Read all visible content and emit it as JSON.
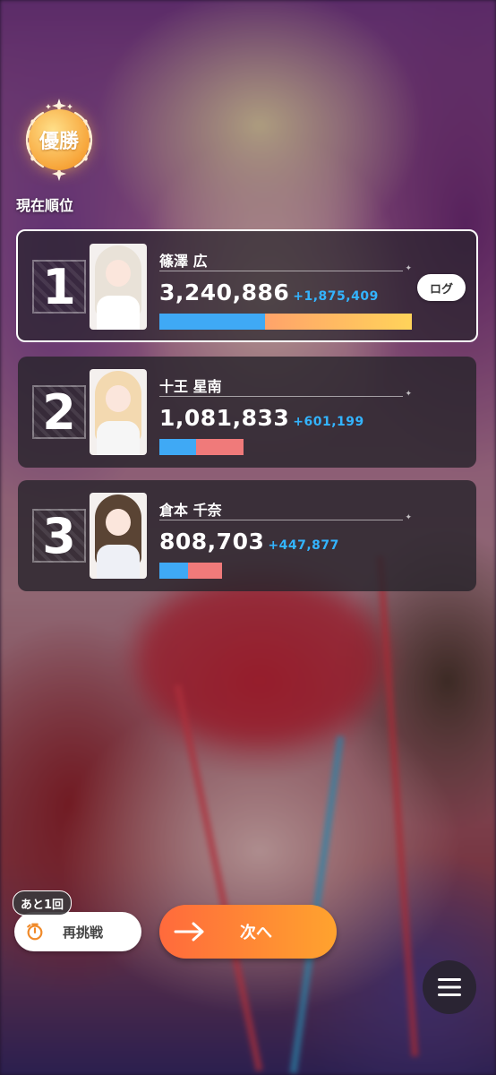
{
  "badge": {
    "label": "優勝"
  },
  "current_rank_label": "現在順位",
  "ranking": [
    {
      "rank": "1",
      "name": "篠澤 広",
      "score": "3,240,886",
      "delta": "+1,875,409",
      "bar": {
        "blue_fraction": 0.42,
        "other_fraction": 0.58,
        "other_color": "#ffb74d"
      },
      "log_button": "ログ",
      "hair_color": "#e9e2d8",
      "outfit_color": "#ffffff"
    },
    {
      "rank": "2",
      "name": "十王 星南",
      "score": "1,081,833",
      "delta": "+601,199",
      "bar": {
        "blue_fraction": 0.44,
        "other_fraction": 0.56,
        "other_color": "#f07a7a"
      },
      "hair_color": "#f3d9b0",
      "outfit_color": "#f6f6f6"
    },
    {
      "rank": "3",
      "name": "倉本 千奈",
      "score": "808,703",
      "delta": "+447,877",
      "bar": {
        "blue_fraction": 0.45,
        "other_fraction": 0.55,
        "other_color": "#f07a7a"
      },
      "hair_color": "#5a4434",
      "outfit_color": "#eef0f6"
    }
  ],
  "controls": {
    "remaining": "あと1回",
    "retry_label": "再挑戦",
    "next_label": "次へ"
  },
  "colors": {
    "accent_blue": "#33b4ff",
    "next_gradient_start": "#ff6a3c",
    "next_gradient_end": "#ffa32e",
    "badge_gold": "#f7a53a"
  },
  "icons": {
    "badge": "laurel-wreath-icon",
    "retry": "stopwatch-icon",
    "next": "arrow-right-icon",
    "menu": "hamburger-menu-icon"
  }
}
